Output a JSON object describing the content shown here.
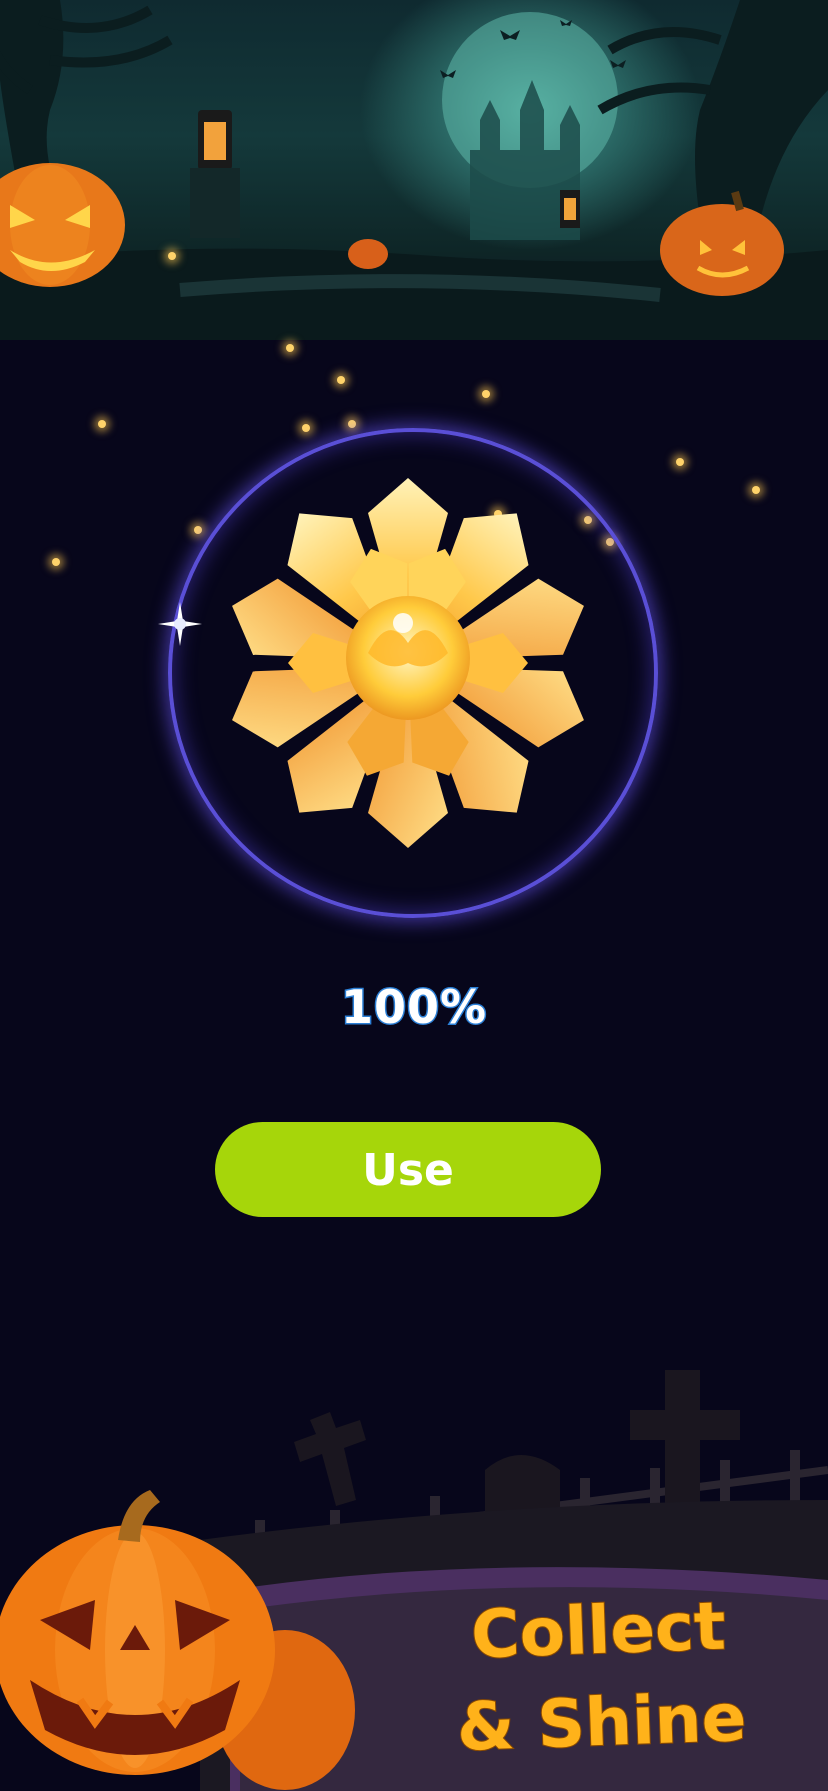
{
  "progress": {
    "percent_text": "100%",
    "value": 1.0
  },
  "actions": {
    "use_label": "Use"
  },
  "promo": {
    "line1": "Collect",
    "line2": "& Shine"
  },
  "icons": {
    "hero_item": "golden-lotus-flower-icon",
    "decor_top": "haunted-forest-banner",
    "decor_bottom": "pumpkin-graveyard-scene"
  },
  "colors": {
    "background": "#07061b",
    "button": "#a6d60a",
    "ring": "#5a4fd6",
    "progress_outline": "#2b7fd6",
    "slogan": "#ffb21a"
  }
}
